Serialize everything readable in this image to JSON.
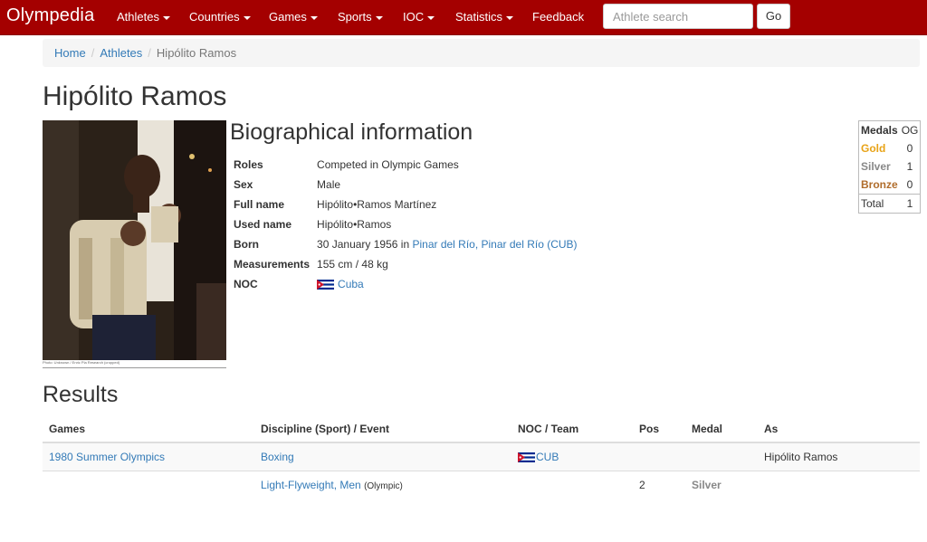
{
  "navbar": {
    "brand": "Olympedia",
    "items": [
      {
        "label": "Athletes",
        "dropdown": true
      },
      {
        "label": "Countries",
        "dropdown": true
      },
      {
        "label": "Games",
        "dropdown": true
      },
      {
        "label": "Sports",
        "dropdown": true
      },
      {
        "label": "IOC",
        "dropdown": true
      },
      {
        "label": "Statistics",
        "dropdown": true
      },
      {
        "label": "Feedback",
        "dropdown": false
      }
    ],
    "search_placeholder": "Athlete search",
    "go_label": "Go",
    "color": "#a40000"
  },
  "breadcrumb": {
    "home": "Home",
    "athletes": "Athletes",
    "current": "Hipólito Ramos"
  },
  "athlete": {
    "name": "Hipólito Ramos",
    "photo_caption": "Photo: Unknown / Enric Pla Research (cropped)"
  },
  "bio": {
    "title": "Biographical information",
    "roles_label": "Roles",
    "roles": "Competed in Olympic Games",
    "sex_label": "Sex",
    "sex": "Male",
    "full_name_label": "Full name",
    "full_name": "Hipólito•Ramos Martínez",
    "used_name_label": "Used name",
    "used_name": "Hipólito•Ramos",
    "born_label": "Born",
    "born_date": "30 January 1956 in ",
    "born_place": "Pinar del Río, Pinar del Río (CUB)",
    "measurements_label": "Measurements",
    "measurements": "155 cm / 48 kg",
    "noc_label": "NOC",
    "noc": "Cuba"
  },
  "medals": {
    "header_label": "Medals",
    "header_og": "OG",
    "gold_label": "Gold",
    "gold": "0",
    "silver_label": "Silver",
    "silver": "1",
    "bronze_label": "Bronze",
    "bronze": "0",
    "total_label": "Total",
    "total": "1",
    "colors": {
      "gold": "#e8a317",
      "silver": "#888888",
      "bronze": "#b06d2c"
    }
  },
  "results": {
    "title": "Results",
    "headers": {
      "games": "Games",
      "discipline": "Discipline (Sport) / Event",
      "noc": "NOC / Team",
      "pos": "Pos",
      "medal": "Medal",
      "as": "As"
    },
    "row1": {
      "games": "1980 Summer Olympics",
      "discipline": "Boxing",
      "noc": "CUB",
      "as": "Hipólito Ramos"
    },
    "row2": {
      "event": "Light-Flyweight, Men",
      "event_note": "(Olympic)",
      "pos": "2",
      "medal": "Silver"
    }
  }
}
